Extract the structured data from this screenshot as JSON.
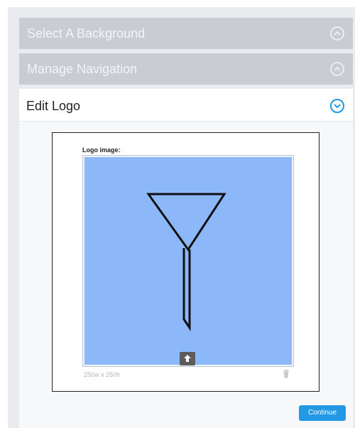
{
  "accordion": {
    "sections": [
      {
        "title": "Select A Background",
        "state": "collapsed"
      },
      {
        "title": "Manage Navigation",
        "state": "collapsed"
      },
      {
        "title": "Edit Logo",
        "state": "expanded"
      }
    ]
  },
  "logo_editor": {
    "label": "Logo image:",
    "dimensions_text": "250w x 250h",
    "image_background_color": "#8cb8fa",
    "upload_icon": "upload-arrow-icon",
    "delete_icon": "trash-icon"
  },
  "actions": {
    "continue_label": "Continue",
    "continue_color": "#2399e6"
  },
  "colors": {
    "accent": "#2399e6",
    "collapsed_header": "#c9ccd1"
  }
}
